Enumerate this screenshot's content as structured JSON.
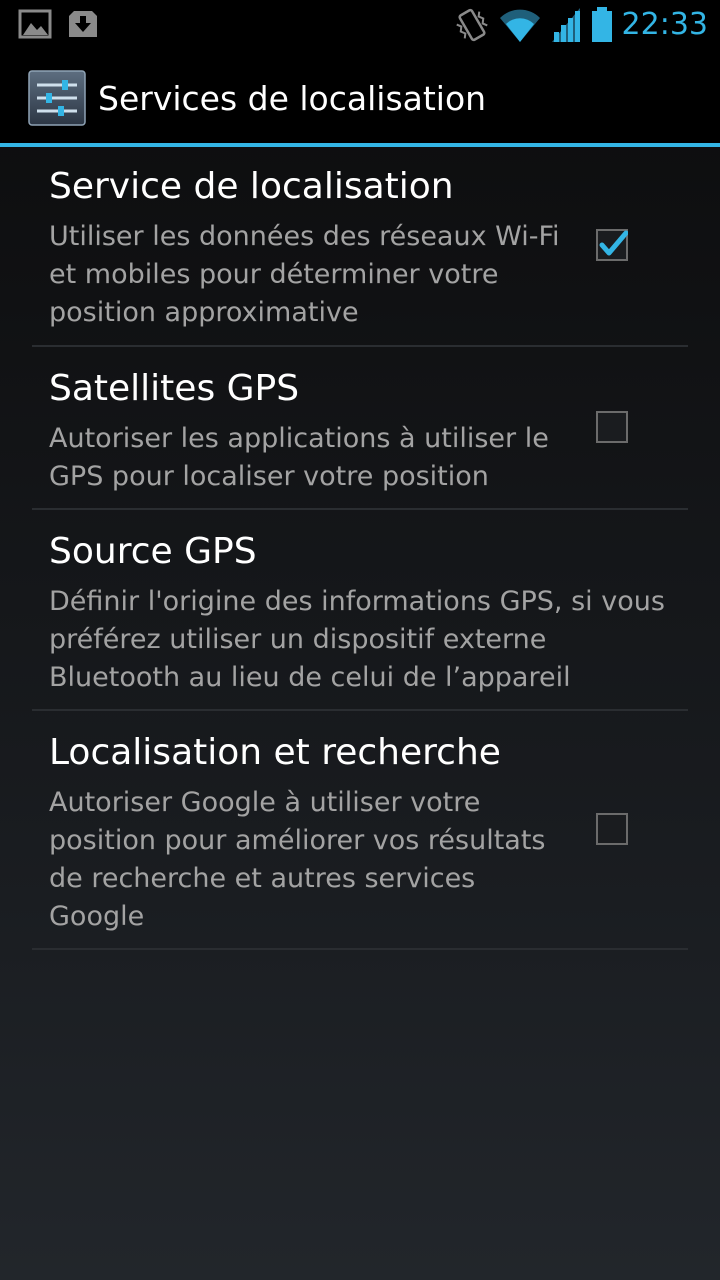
{
  "status_bar": {
    "time": "22:33",
    "icons": [
      "picture-notification-icon",
      "download-notification-icon",
      "vibrate-icon",
      "wifi-icon",
      "cell-signal-icon",
      "battery-icon"
    ]
  },
  "action_bar": {
    "title": "Services de localisation",
    "icon": "settings-sliders-icon"
  },
  "settings": [
    {
      "title": "Service de localisation",
      "summary": "Utiliser les données des réseaux Wi-Fi et mobiles pour déterminer votre position approximative",
      "checked": true
    },
    {
      "title": "Satellites GPS",
      "summary": "Autoriser les applications à utiliser le GPS pour localiser votre position",
      "checked": false
    },
    {
      "title": "Source GPS",
      "summary": "Définir l'origine des informations GPS, si vous préférez utiliser un dispositif externe Bluetooth au lieu de celui de l’appareil"
    },
    {
      "title": "Localisation et recherche",
      "summary": "Autoriser Google à utiliser votre position pour améliorer vos résultats de recherche et autres services Google",
      "checked": false
    }
  ],
  "colors": {
    "accent": "#33b5e5",
    "background": "#101113",
    "summary_text": "#a3a3a3",
    "divider": "#2a2d31"
  }
}
